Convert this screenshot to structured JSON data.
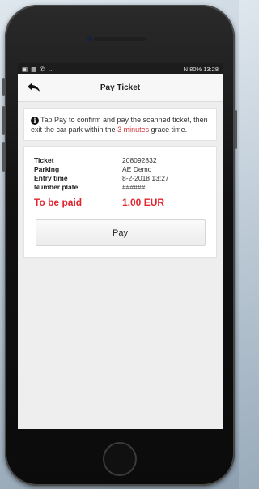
{
  "status_bar": {
    "left_icons": [
      "image-icon",
      "gallery-icon",
      "whatsapp-icon",
      "more-icon"
    ],
    "right_text": "N  80% 13:28"
  },
  "app_bar": {
    "title": "Pay Ticket"
  },
  "info": {
    "text_before": "Tap Pay to confirm and pay the scanned ticket, then exit the car park within the ",
    "highlight": "3 minutes",
    "text_after": " grace time."
  },
  "ticket": {
    "rows": [
      {
        "label": "Ticket",
        "value": "208092832"
      },
      {
        "label": "Parking",
        "value": "AE Demo"
      },
      {
        "label": "Entry time",
        "value": "8-2-2018 13:27"
      },
      {
        "label": "Number plate",
        "value": "######"
      }
    ],
    "due_label": "To be paid",
    "due_value": "1.00 EUR"
  },
  "pay_button": {
    "label": "Pay"
  },
  "colors": {
    "accent_red": "#e0252e",
    "highlight_red": "#d0323a"
  }
}
